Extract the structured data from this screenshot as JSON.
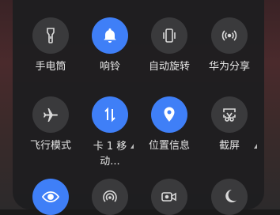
{
  "tiles": [
    {
      "label": "手电筒"
    },
    {
      "label": "响铃"
    },
    {
      "label": "自动旋转"
    },
    {
      "label": "华为分享"
    },
    {
      "label": "飞行模式"
    },
    {
      "label": "卡 1 移动..."
    },
    {
      "label": "位置信息"
    },
    {
      "label": "截屏"
    }
  ],
  "colors": {
    "accent": "#3f7ff7",
    "inactive": "#3a3a3c",
    "panel": "#1e1e20"
  }
}
